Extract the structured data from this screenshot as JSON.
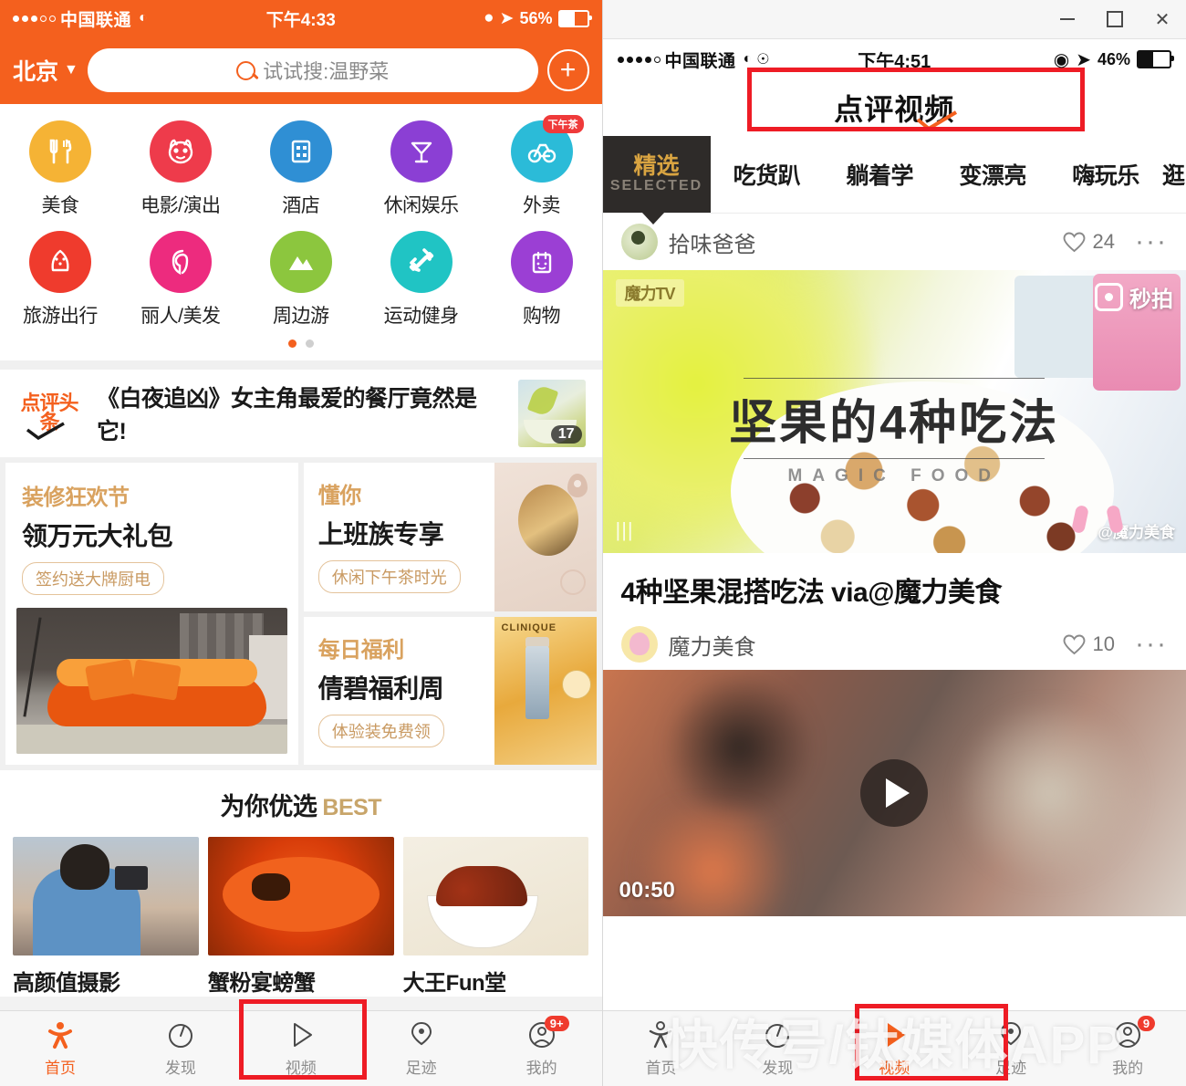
{
  "left": {
    "status": {
      "carrier": "中国联通",
      "time": "下午4:33",
      "battery": "56%"
    },
    "search": {
      "city": "北京",
      "placeholder": "试试搜:温野菜",
      "add_label": "+"
    },
    "grid": [
      {
        "label": "美食",
        "icon": "fork-knife-icon",
        "color": "#f5b335",
        "badge": ""
      },
      {
        "label": "电影/演出",
        "icon": "cat-face-icon",
        "color": "#ee3b4b",
        "badge": ""
      },
      {
        "label": "酒店",
        "icon": "hotel-building-icon",
        "color": "#2f8fd4",
        "badge": ""
      },
      {
        "label": "休闲娱乐",
        "icon": "cocktail-icon",
        "color": "#8b3fd4",
        "badge": ""
      },
      {
        "label": "外卖",
        "icon": "scooter-icon",
        "color": "#2bbbd8",
        "badge": "下午茶"
      },
      {
        "label": "旅游出行",
        "icon": "compass-icon",
        "color": "#ef3b2d",
        "badge": ""
      },
      {
        "label": "丽人/美发",
        "icon": "hair-beauty-icon",
        "color": "#ed2b7e",
        "badge": ""
      },
      {
        "label": "周边游",
        "icon": "mountain-icon",
        "color": "#8cc63e",
        "badge": ""
      },
      {
        "label": "运动健身",
        "icon": "dumbbell-icon",
        "color": "#20c4c4",
        "badge": ""
      },
      {
        "label": "购物",
        "icon": "shopping-bag-icon",
        "color": "#9b3fd4",
        "badge": ""
      }
    ],
    "pager": {
      "total": 2,
      "active": 1
    },
    "news": {
      "logo_text": "点评头条",
      "title": "《白夜追凶》女主角最爱的餐厅竟然是它!",
      "badge": "17"
    },
    "promos": {
      "big": {
        "sub": "装修狂欢节",
        "main": "领万元大礼包",
        "pill": "签约送大牌厨电"
      },
      "card1": {
        "sub": "懂你",
        "main": "上班族专享",
        "pill": "休闲下午茶时光"
      },
      "card2": {
        "sub": "每日福利",
        "main": "倩碧福利周",
        "pill": "体验装免费领"
      }
    },
    "best": {
      "title_cn": "为你优选",
      "title_en": "BEST",
      "items": [
        {
          "label": "高颜值摄影"
        },
        {
          "label": "蟹粉宴螃蟹"
        },
        {
          "label": "大王Fun堂"
        }
      ]
    },
    "tabbar": [
      {
        "label": "首页",
        "icon": "home-person-icon",
        "active": true,
        "badge": ""
      },
      {
        "label": "发现",
        "icon": "compass-discover-icon",
        "active": false,
        "badge": ""
      },
      {
        "label": "视频",
        "icon": "play-triangle-icon",
        "active": false,
        "badge": ""
      },
      {
        "label": "足迹",
        "icon": "location-pin-icon",
        "active": false,
        "badge": ""
      },
      {
        "label": "我的",
        "icon": "user-profile-icon",
        "active": false,
        "badge": "9+"
      }
    ]
  },
  "right": {
    "window": {
      "minimize": "—",
      "maximize": "□",
      "close": "✕"
    },
    "status": {
      "carrier": "中国联通",
      "time": "下午4:51",
      "battery": "46%"
    },
    "title": "点评视频",
    "tabs": [
      {
        "cn": "精选",
        "en": "SELECTED",
        "active": true
      },
      {
        "cn": "吃货趴",
        "active": false
      },
      {
        "cn": "躺着学",
        "active": false
      },
      {
        "cn": "变漂亮",
        "active": false
      },
      {
        "cn": "嗨玩乐",
        "active": false
      },
      {
        "cn": "逛",
        "active": false
      }
    ],
    "posts": [
      {
        "author": "拾味爸爸",
        "likes": "24",
        "more": "···",
        "thumb": {
          "overlay_title": "坚果的4种吃法",
          "overlay_sub": "MAGIC FOOD",
          "logo": "魔力TV",
          "watermark": "秒拍",
          "creator_tag": "@魔力美食"
        }
      },
      {
        "caption": "4种坚果混搭吃法 via@魔力美食",
        "author": "魔力美食",
        "likes": "10",
        "more": "···",
        "duration": "00:50"
      }
    ],
    "tabbar": [
      {
        "label": "首页",
        "icon": "home-person-icon",
        "active": false,
        "badge": ""
      },
      {
        "label": "发现",
        "icon": "compass-discover-icon",
        "active": false,
        "badge": ""
      },
      {
        "label": "视频",
        "icon": "play-triangle-icon",
        "active": true,
        "badge": ""
      },
      {
        "label": "足迹",
        "icon": "location-pin-icon",
        "active": false,
        "badge": ""
      },
      {
        "label": "我的",
        "icon": "user-profile-icon",
        "active": false,
        "badge": "9"
      }
    ],
    "watermark": "快传号/钛媒体APP"
  }
}
